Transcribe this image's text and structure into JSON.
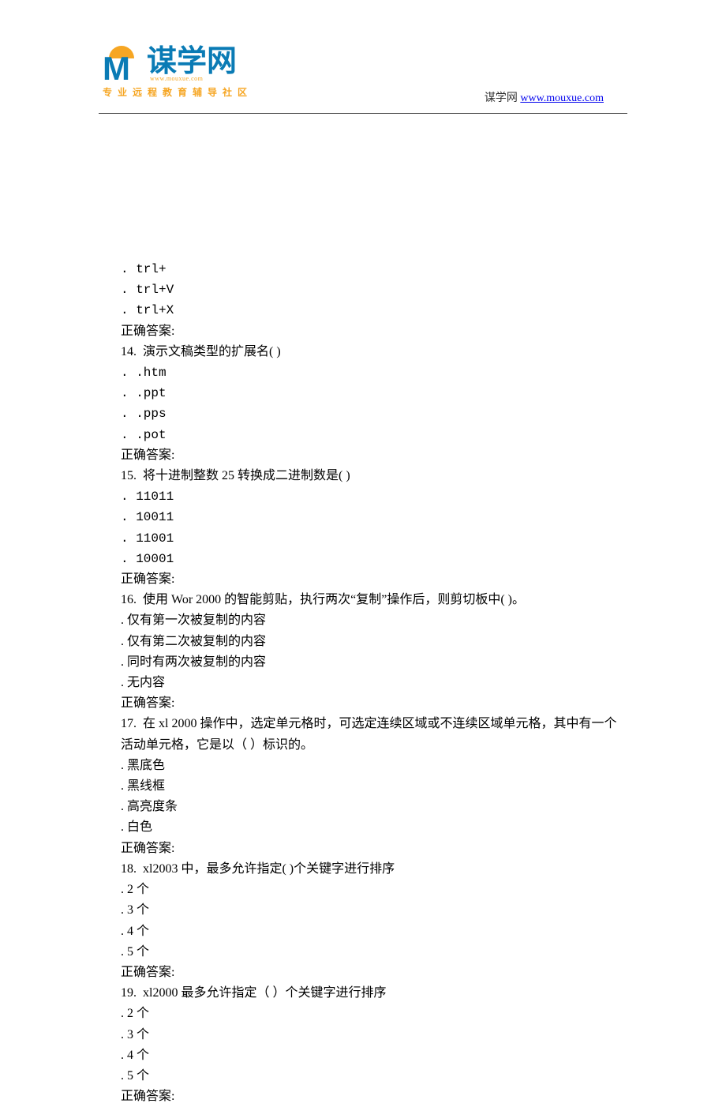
{
  "header": {
    "logo_text": "谋学网",
    "logo_url": "www.mouxue.com",
    "logo_tagline": "专业远程教育辅导社区",
    "right_label": "谋学网 ",
    "right_link": "www.mouxue.com"
  },
  "lines": [
    {
      "t": ". trl+",
      "mono": true
    },
    {
      "t": ". trl+V",
      "mono": true
    },
    {
      "t": ". trl+X",
      "mono": true
    },
    {
      "t": "正确答案:"
    },
    {
      "t": "14.  演示文稿类型的扩展名( )"
    },
    {
      "t": ". .htm",
      "mono": true
    },
    {
      "t": ". .ppt",
      "mono": true
    },
    {
      "t": ". .pps",
      "mono": true
    },
    {
      "t": ". .pot",
      "mono": true
    },
    {
      "t": "正确答案:"
    },
    {
      "t": "15.  将十进制整数 25 转换成二进制数是( )"
    },
    {
      "t": ". 11011",
      "mono": true
    },
    {
      "t": ". 10011",
      "mono": true
    },
    {
      "t": ". 11001",
      "mono": true
    },
    {
      "t": ". 10001",
      "mono": true
    },
    {
      "t": "正确答案:"
    },
    {
      "t": "16.  使用 Wor 2000 的智能剪贴，执行两次“复制”操作后，则剪切板中( )。"
    },
    {
      "t": ". 仅有第一次被复制的内容"
    },
    {
      "t": ". 仅有第二次被复制的内容"
    },
    {
      "t": ". 同时有两次被复制的内容"
    },
    {
      "t": ". 无内容"
    },
    {
      "t": "正确答案:"
    },
    {
      "t": "17.  在 xl 2000 操作中，选定单元格时，可选定连续区域或不连续区域单元格，其中有一个活动单元格，它是以（ ）标识的。"
    },
    {
      "t": ". 黑底色"
    },
    {
      "t": ". 黑线框"
    },
    {
      "t": ". 高亮度条"
    },
    {
      "t": ". 白色"
    },
    {
      "t": "正确答案:"
    },
    {
      "t": "18.  xl2003 中，最多允许指定( )个关键字进行排序"
    },
    {
      "t": ". 2 个"
    },
    {
      "t": ". 3 个"
    },
    {
      "t": ". 4 个"
    },
    {
      "t": ". 5 个"
    },
    {
      "t": "正确答案:"
    },
    {
      "t": "19.  xl2000 最多允许指定（ ）个关键字进行排序"
    },
    {
      "t": ". 2 个"
    },
    {
      "t": ". 3 个"
    },
    {
      "t": ". 4 个"
    },
    {
      "t": ". 5 个"
    },
    {
      "t": "正确答案:"
    }
  ]
}
